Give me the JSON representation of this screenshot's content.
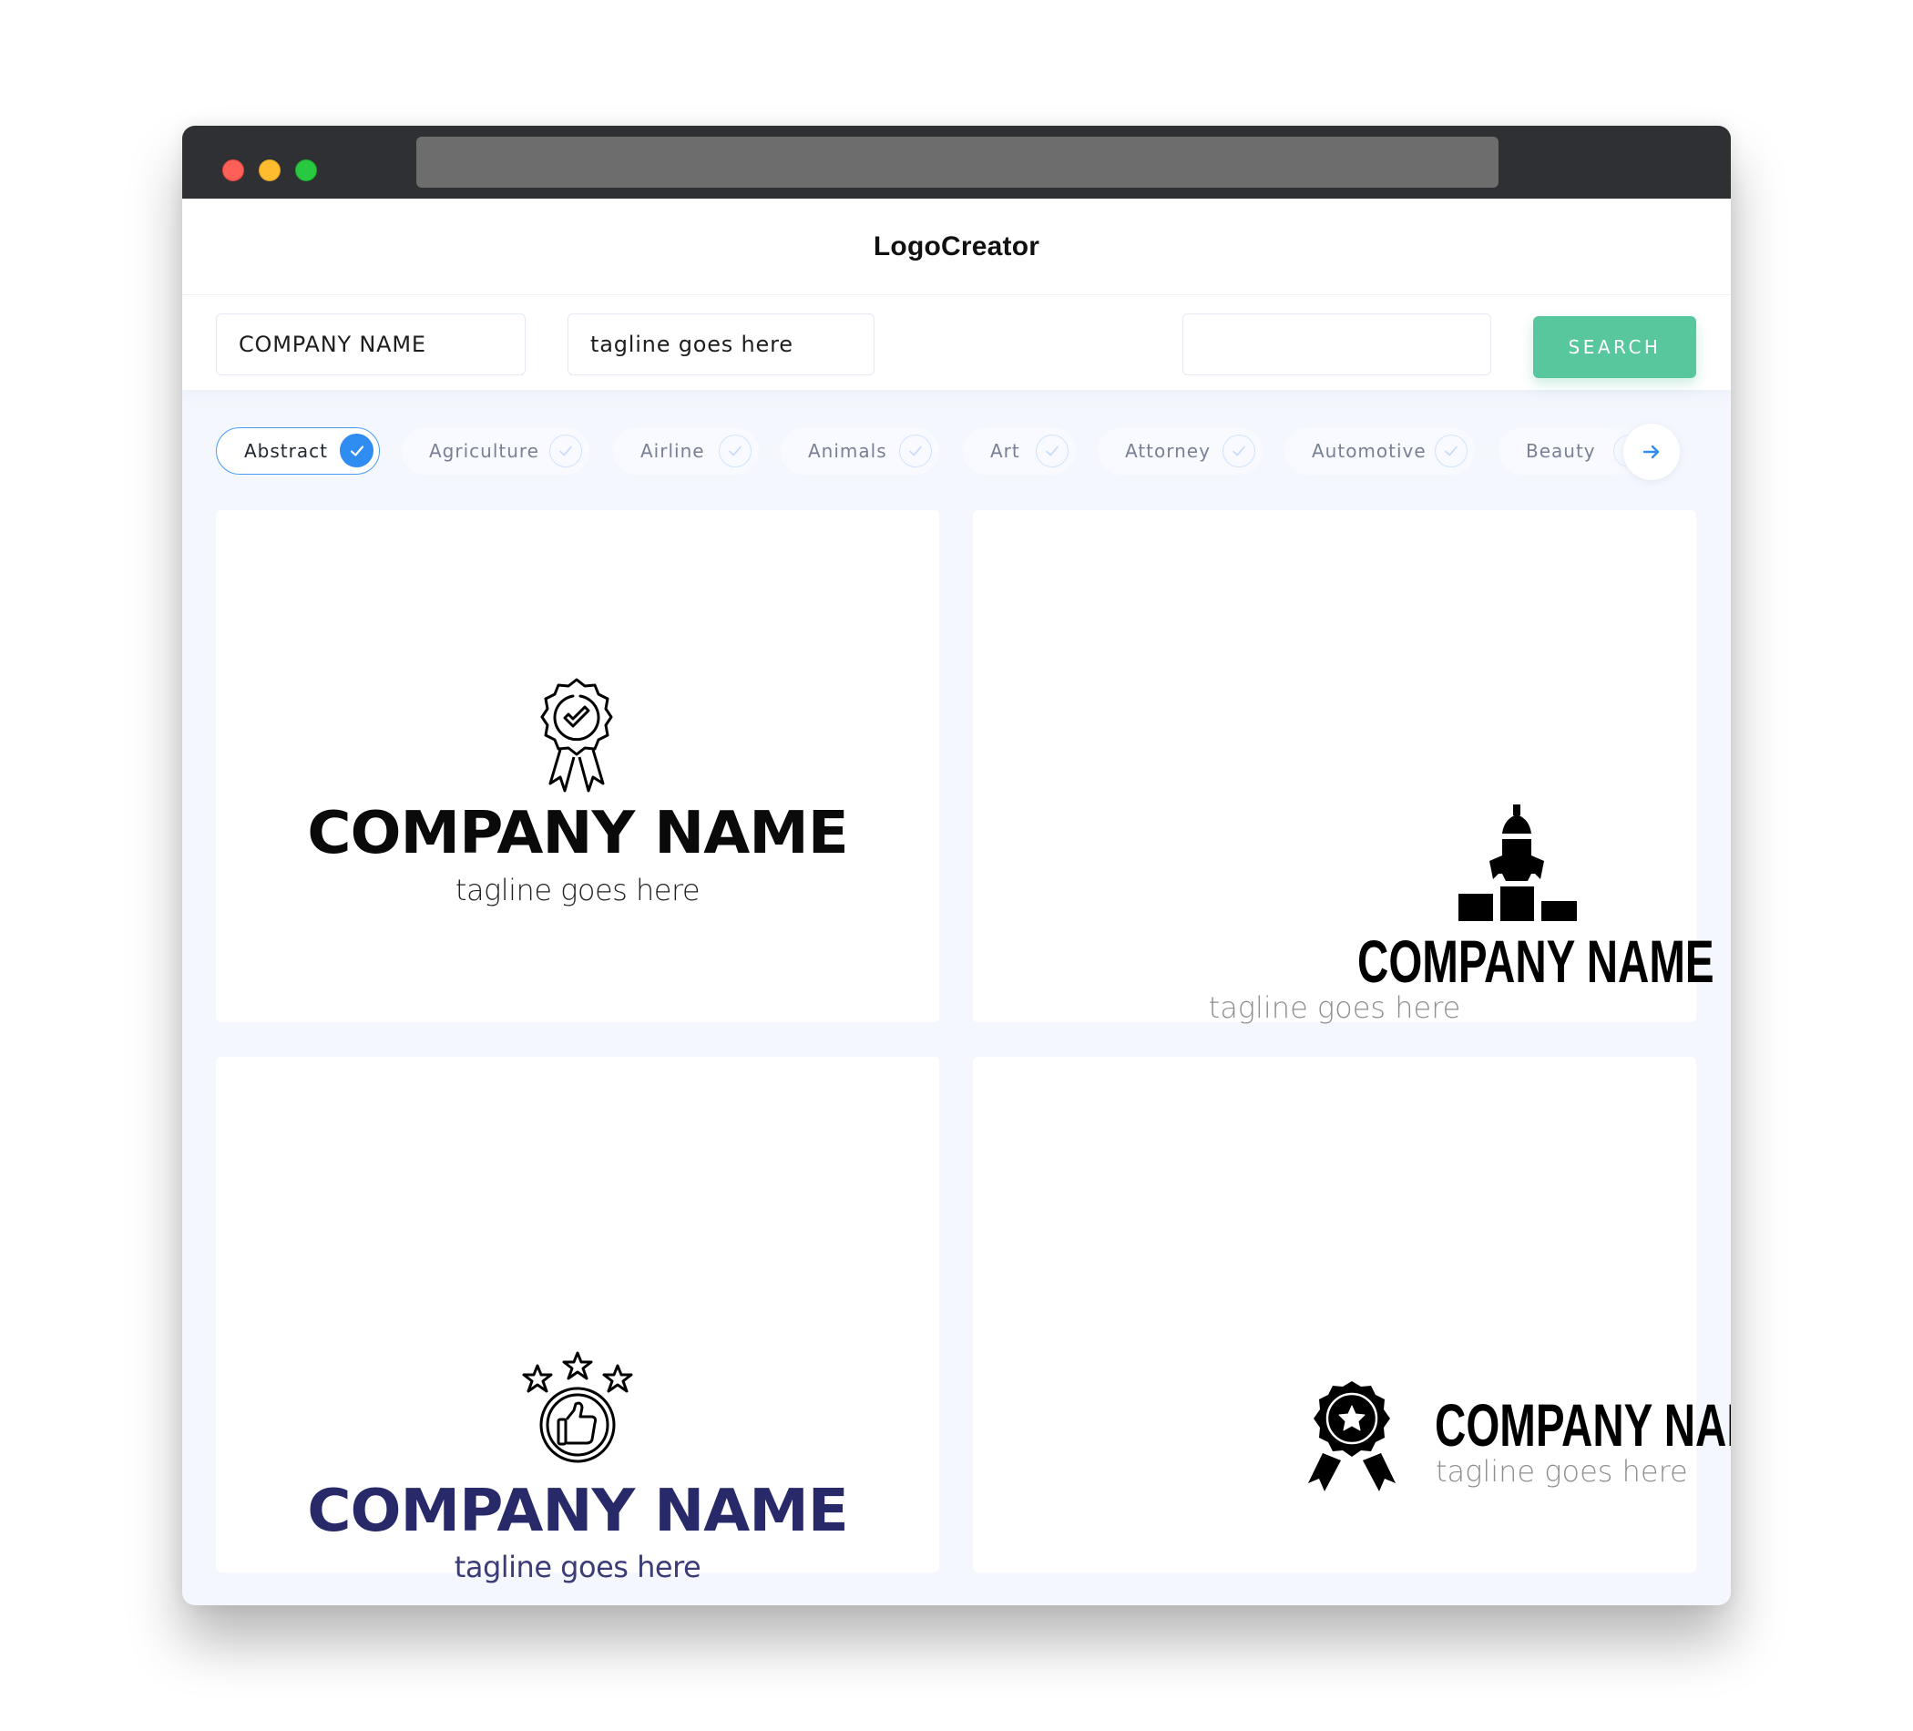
{
  "window": {
    "traffic_lights": [
      "close",
      "minimize",
      "maximize"
    ],
    "address_bar": ""
  },
  "header": {
    "title": "LogoCreator"
  },
  "search": {
    "company_value": "COMPANY NAME",
    "tagline_value": "tagline goes here",
    "keyword_value": "",
    "search_label": "SEARCH"
  },
  "categories": {
    "items": [
      {
        "label": "Abstract",
        "selected": true
      },
      {
        "label": "Agriculture",
        "selected": false
      },
      {
        "label": "Airline",
        "selected": false
      },
      {
        "label": "Animals",
        "selected": false
      },
      {
        "label": "Art",
        "selected": false
      },
      {
        "label": "Attorney",
        "selected": false
      },
      {
        "label": "Automotive",
        "selected": false
      },
      {
        "label": "Beauty",
        "selected": false
      }
    ],
    "next_icon": "arrow-right-icon"
  },
  "logos": [
    {
      "icon": "award-badge-check-icon",
      "company": "COMPANY NAME",
      "tagline": "tagline goes here",
      "color": "#0a0a0a",
      "layout": "stacked"
    },
    {
      "icon": "rocket-podium-icon",
      "company": "COMPANY NAME",
      "tagline": "tagline goes here",
      "color": "#000000",
      "layout": "stacked"
    },
    {
      "icon": "thumbs-up-stars-icon",
      "company": "COMPANY NAME",
      "tagline": "tagline goes here",
      "color": "#282968",
      "layout": "stacked"
    },
    {
      "icon": "star-rosette-icon",
      "company": "COMPANY NAME",
      "tagline": "tagline goes here",
      "color": "#000000",
      "layout": "inline"
    }
  ],
  "colors": {
    "accent_blue": "#2f8cf0",
    "search_green": "#58c79e",
    "navy": "#282968"
  }
}
